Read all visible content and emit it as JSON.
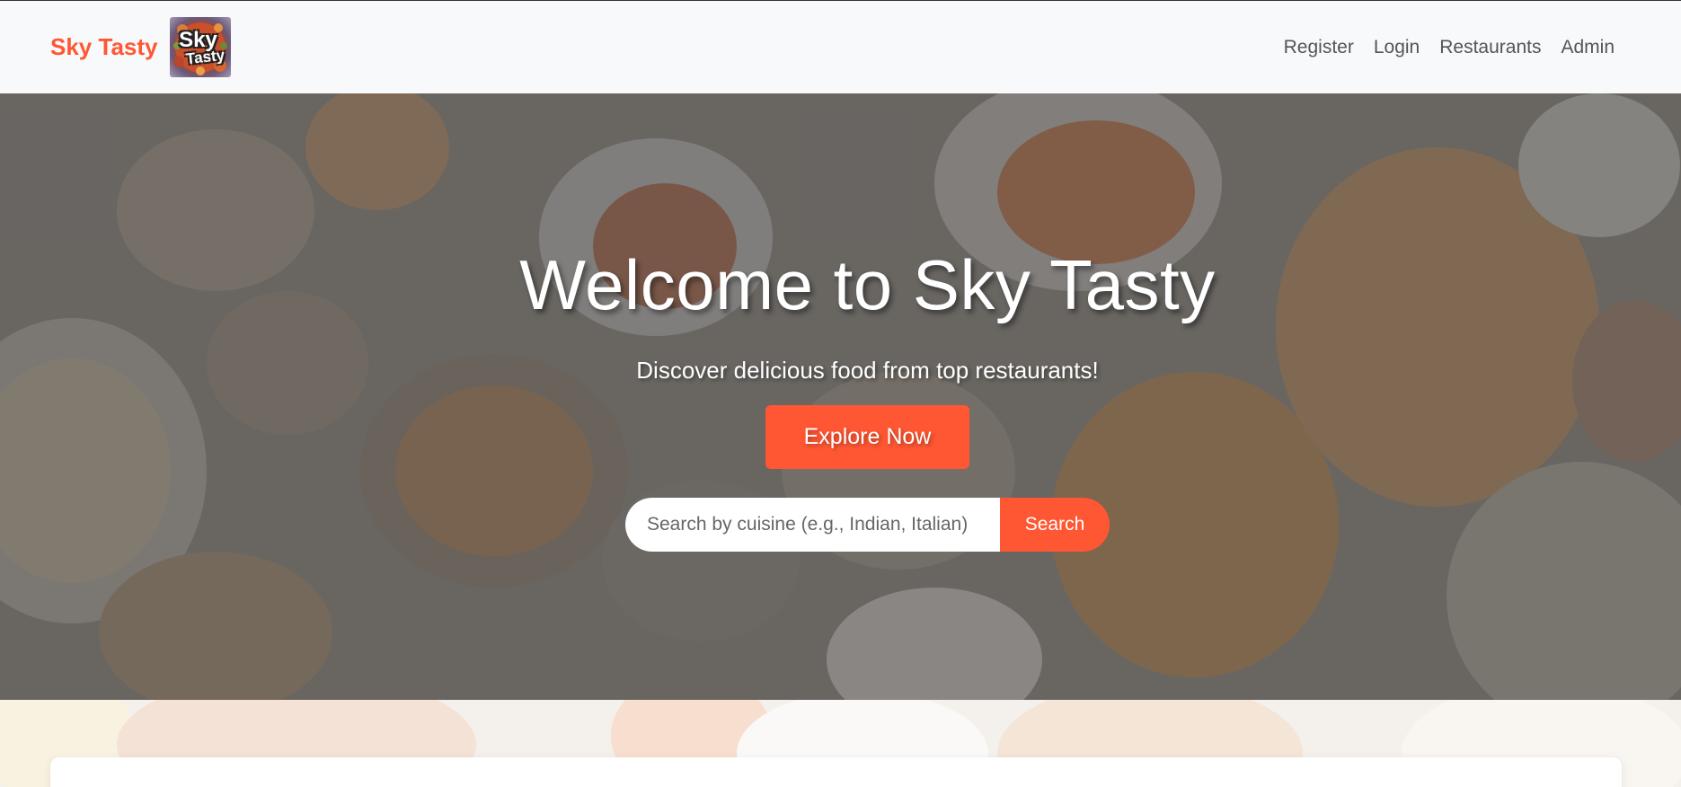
{
  "brand": {
    "name": "Sky Tasty",
    "logo_line1": "Sky",
    "logo_line2": "Tasty"
  },
  "nav": {
    "items": [
      "Register",
      "Login",
      "Restaurants",
      "Admin"
    ]
  },
  "hero": {
    "title": "Welcome to Sky Tasty",
    "subtitle": "Discover delicious food from top restaurants!",
    "cta_label": "Explore Now",
    "search": {
      "placeholder": "Search by cuisine (e.g., Indian, Italian)",
      "value": "",
      "button_label": "Search"
    }
  },
  "colors": {
    "accent": "#ff5733",
    "navbar_bg": "#f8f9fa",
    "nav_text": "#555555"
  }
}
